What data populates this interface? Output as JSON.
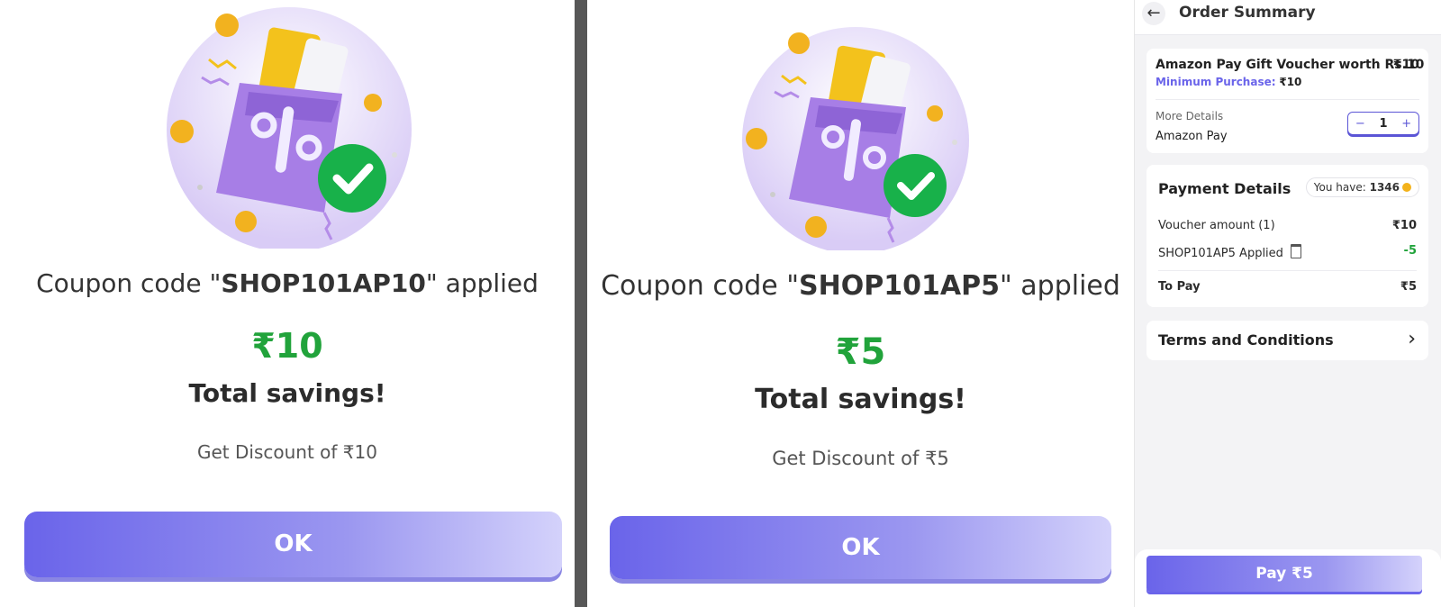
{
  "popup1": {
    "coupon_prefix": "Coupon code \"",
    "coupon_code": "SHOP101AP10",
    "coupon_suffix": "\" applied",
    "amount": "₹10",
    "savings_label": "Total savings!",
    "discount_text": "Get Discount of ₹10",
    "ok_label": "OK"
  },
  "popup2": {
    "coupon_prefix": "Coupon code \"",
    "coupon_code": "SHOP101AP5",
    "coupon_suffix": "\" applied",
    "amount": "₹5",
    "savings_label": "Total savings!",
    "discount_text": "Get Discount of ₹5",
    "ok_label": "OK"
  },
  "order_summary": {
    "title": "Order Summary",
    "product": {
      "name": "Amazon Pay Gift Voucher worth Rs.10",
      "price": "₹10",
      "min_purchase_label": "Minimum Purchase:",
      "min_purchase_value": "₹10",
      "more_details_label": "More Details",
      "brand": "Amazon Pay",
      "quantity": "1",
      "minus": "−",
      "plus": "+"
    },
    "payment": {
      "title": "Payment Details",
      "you_have_label": "You have:",
      "coins": "1346",
      "voucher_label": "Voucher amount (1)",
      "voucher_value": "₹10",
      "coupon_label": "SHOP101AP5 Applied",
      "coupon_value": "-5",
      "topay_label": "To Pay",
      "topay_value": "₹5"
    },
    "terms_label": "Terms and Conditions",
    "pay_button": "Pay ₹5"
  },
  "colors": {
    "accent": "#6a64ea",
    "success": "#21a33b",
    "min_purchase": "#6a64ea"
  }
}
